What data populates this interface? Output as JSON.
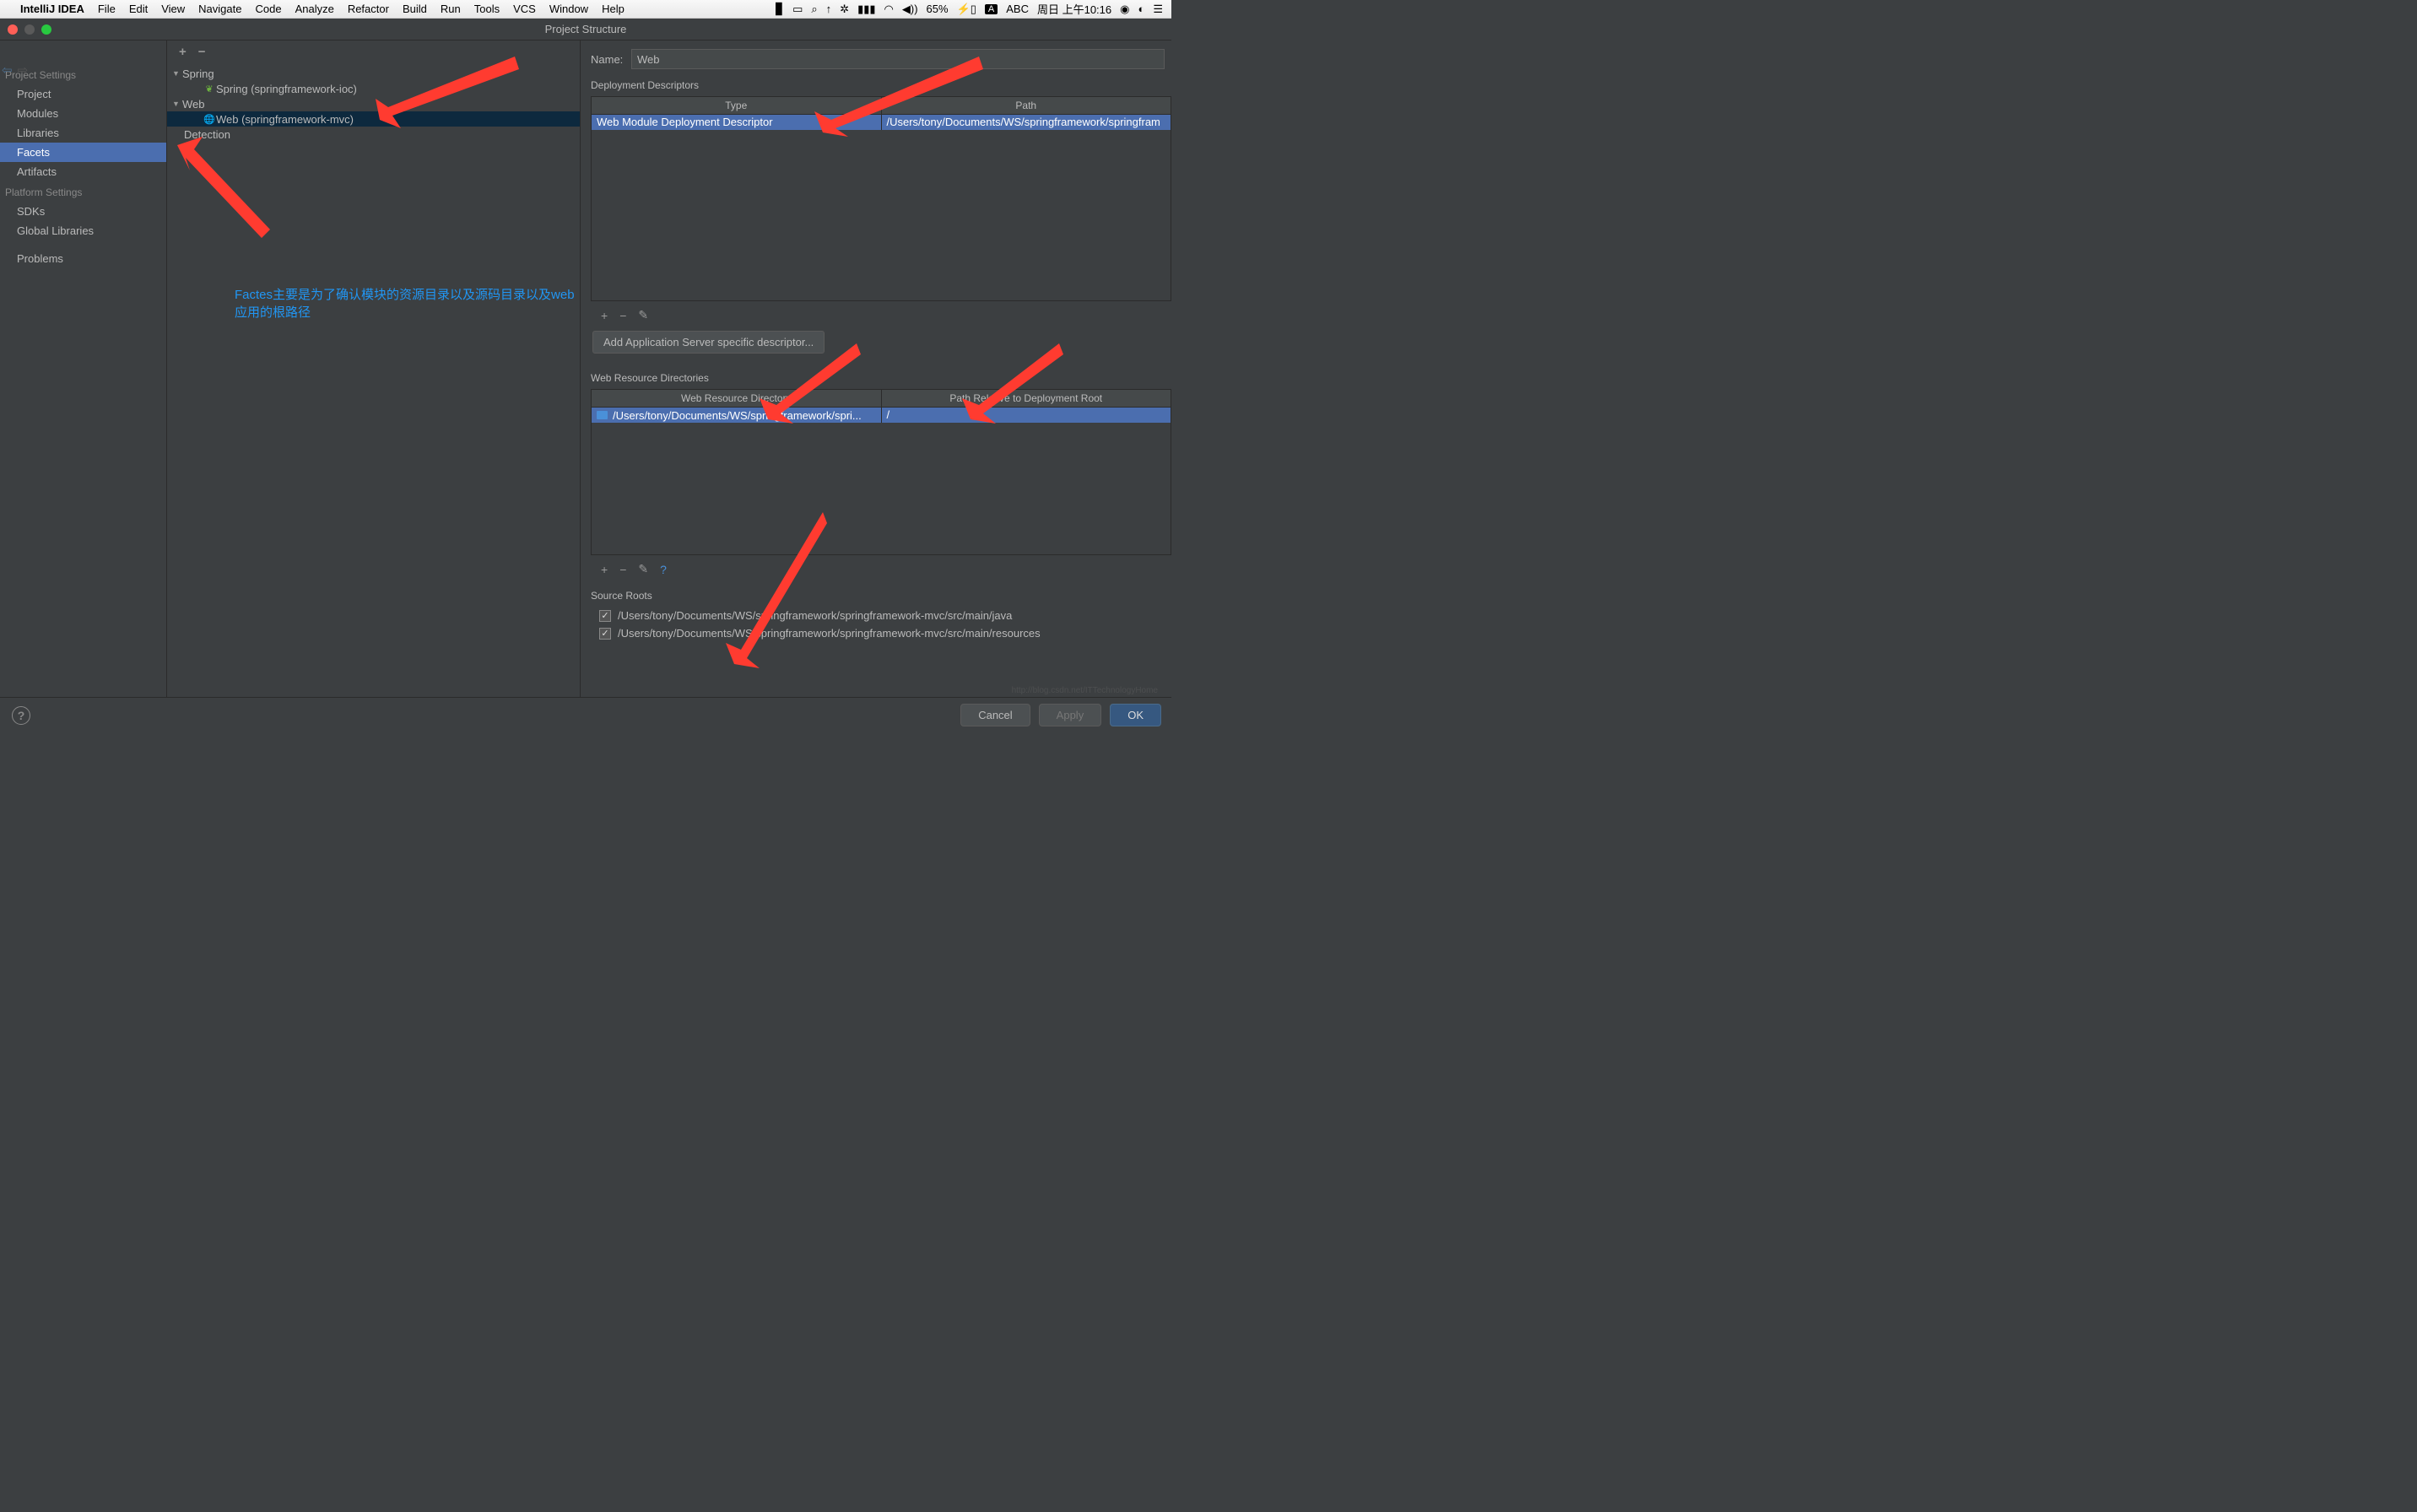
{
  "menubar": {
    "app": "IntelliJ IDEA",
    "items": [
      "File",
      "Edit",
      "View",
      "Navigate",
      "Code",
      "Analyze",
      "Refactor",
      "Build",
      "Run",
      "Tools",
      "VCS",
      "Window",
      "Help"
    ],
    "battery": "65%",
    "input_a": "A",
    "input_abc": "ABC",
    "datetime": "周日 上午10:16"
  },
  "window": {
    "title": "Project Structure"
  },
  "sidebar": {
    "project_settings_header": "Project Settings",
    "project_settings": [
      "Project",
      "Modules",
      "Libraries",
      "Facets",
      "Artifacts"
    ],
    "platform_settings_header": "Platform Settings",
    "platform_settings": [
      "SDKs",
      "Global Libraries"
    ],
    "problems": "Problems",
    "selected": "Facets"
  },
  "tree": {
    "spring": "Spring",
    "spring_child": "Spring (springframework-ioc)",
    "web": "Web",
    "web_child": "Web (springframework-mvc)",
    "detection": "Detection"
  },
  "annotation_text": "Factes主要是为了确认模块的资源目录以及源码目录以及web应用的根路径",
  "form": {
    "name_label": "Name:",
    "name_value": "Web",
    "dd_header": "Deployment Descriptors",
    "dd_cols": [
      "Type",
      "Path"
    ],
    "dd_row": {
      "type": "Web Module Deployment Descriptor",
      "path": "/Users/tony/Documents/WS/springframework/springfram"
    },
    "desc_btn": "Add Application Server specific descriptor...",
    "wr_header": "Web Resource Directories",
    "wr_cols": [
      "Web Resource Directory",
      "Path Relative to Deployment Root"
    ],
    "wr_row": {
      "dir": "/Users/tony/Documents/WS/springframework/spri...",
      "path": "/"
    },
    "sr_header": "Source Roots",
    "sr_rows": [
      "/Users/tony/Documents/WS/springframework/springframework-mvc/src/main/java",
      "/Users/tony/Documents/WS/springframework/springframework-mvc/src/main/resources"
    ]
  },
  "footer": {
    "cancel": "Cancel",
    "apply": "Apply",
    "ok": "OK"
  },
  "watermark": "http://blog.csdn.net/ITTechnologyHome"
}
